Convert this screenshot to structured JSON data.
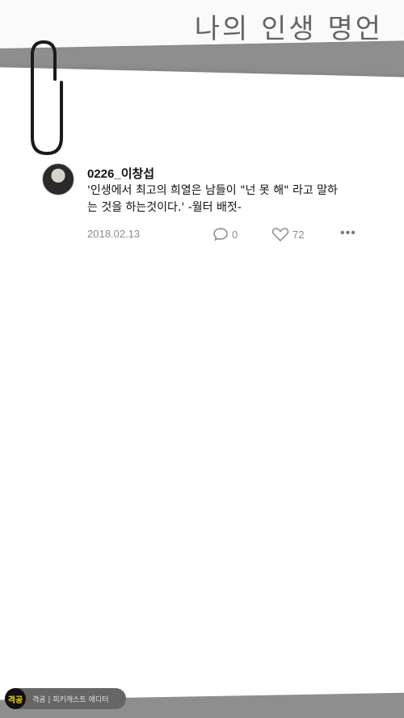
{
  "header": {
    "title": "나의 인생 명언"
  },
  "post": {
    "username": "0226_이창섭",
    "text": "'인생에서 최고의 희열은 남들이 \"넌 못 해\" 라고 말하는 것을 하는것이다.' -월터 배젓-",
    "date": "2018.02.13",
    "comment_count": "0",
    "like_count": "72",
    "more_label": "•••"
  },
  "footer_badge": {
    "logo_text": "격공",
    "text": "격공 | 피키캐스트 에디터"
  },
  "colors": {
    "strip": "#8e8e8e",
    "paper": "#ffffff",
    "badge_logo": "#f5d300"
  }
}
